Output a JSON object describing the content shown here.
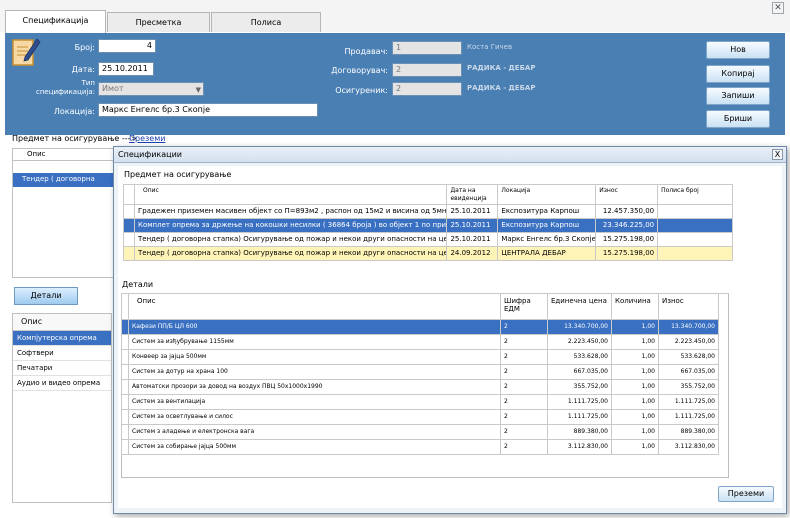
{
  "tabs": [
    {
      "label": "Спецификација",
      "active": true
    },
    {
      "label": "Пресметка",
      "active": false
    },
    {
      "label": "Полиса",
      "active": false
    }
  ],
  "header": {
    "broj_label": "Број:",
    "broj_value": "4",
    "datum_label": "Дата:",
    "datum_value": "25.10.2011",
    "tip_label": "Тип спецификација:",
    "tip_value": "Имот",
    "lokacija_label": "Локација:",
    "lokacija_value": "Маркс Енгелс бр.3 Скопје",
    "prodavac_label": "Продавач:",
    "prodavac_code": "1",
    "prodavac_name": "Коста Гичев",
    "dogovorvac_label": "Договорувач:",
    "dogovorvac_code": "2",
    "dogovorvac_name": "РАДИКА - ДЕБАР",
    "osiguren_label": "Осигуреник:",
    "osiguren_code": "2",
    "osiguren_name": "РАДИКА - ДЕБАР"
  },
  "actions": {
    "nov": "Нов",
    "kopiraj": "Копирај",
    "zapisi": "Запиши",
    "brisi": "Бриши"
  },
  "left": {
    "predmet_label": "Предмет на осигурување --->",
    "prezemi_link": "Преземи",
    "grid_header": "Опис",
    "grid_rows": [
      "Тендер ( договорна стапка)"
    ],
    "detali_button": "Детали",
    "cat_header": "Опис",
    "categories": [
      "Компјутерска опрема",
      "Софтвери",
      "Печатари",
      "Аудио и видео опрема"
    ]
  },
  "dialog": {
    "title": "Спецификации",
    "close": "X",
    "section1": "Предмет на осигурување",
    "grid1_headers": [
      "Опис",
      "Дата на евиденција",
      "Локација",
      "Износ",
      "Полиса број"
    ],
    "grid1_rows": [
      {
        "opis": "Градежен приземен масивен објект со П=893м2 , распон од 15м2 и висина од 5мна сума ...",
        "data": "25.10.2011",
        "lokacija": "Експозитура Карпош",
        "iznos": "12.457.350,00",
        "polisa": ""
      },
      {
        "opis": "Комплет опрема за држење на кокошки несилки ( 36864 броја ) во објект 1 по приложен...",
        "data": "25.10.2011",
        "lokacija": "Експозитура Карпош",
        "iznos": "23.346.225,00",
        "polisa": ""
      },
      {
        "opis": "Тендер ( договорна стапка) Осигурување од пожар и некои други опасности на целокуп...",
        "data": "25.10.2011",
        "lokacija": "Маркс Енгелс бр.3 Скопје",
        "iznos": "15.275.198,00",
        "polisa": ""
      },
      {
        "opis": "Тендер ( договорна стапка) Осигурување од пожар и некои други опасности на целокуп...",
        "data": "24.09.2012",
        "lokacija": "ЦЕНТРАЛА ДЕБАР",
        "iznos": "15.275.198,00",
        "polisa": ""
      }
    ],
    "section2": "Детали",
    "grid2_headers": [
      "Опис",
      "Шифра ЕДМ",
      "Единечна цена",
      "Количина",
      "Износ"
    ],
    "grid2_rows": [
      {
        "opis": "Кафези ПП/Б ЦЛ 600",
        "sifra": "2",
        "cena": "13.340.700,00",
        "kolicina": "1,00",
        "iznos": "13.340.700,00"
      },
      {
        "opis": "Систем за изђубрување 1155мм",
        "sifra": "2",
        "cena": "2.223.450,00",
        "kolicina": "1,00",
        "iznos": "2.223.450,00"
      },
      {
        "opis": "Конвеер за јајца 500мм",
        "sifra": "2",
        "cena": "533.628,00",
        "kolicina": "1,00",
        "iznos": "533.628,00"
      },
      {
        "opis": "Систем за дотур на храна 100",
        "sifra": "2",
        "cena": "667.035,00",
        "kolicina": "1,00",
        "iznos": "667.035,00"
      },
      {
        "opis": "Автоматски прозори за довод на воздух ПВЦ 50x1000x1990",
        "sifra": "2",
        "cena": "355.752,00",
        "kolicina": "1,00",
        "iznos": "355.752,00"
      },
      {
        "opis": "Систем за вентилација",
        "sifra": "2",
        "cena": "1.111.725,00",
        "kolicina": "1,00",
        "iznos": "1.111.725,00"
      },
      {
        "opis": "Систем за осветлување и силос",
        "sifra": "2",
        "cena": "1.111.725,00",
        "kolicina": "1,00",
        "iznos": "1.111.725,00"
      },
      {
        "opis": "Систем з аладење и електронска вага",
        "sifra": "2",
        "cena": "889.380,00",
        "kolicina": "1,00",
        "iznos": "889.380,00"
      },
      {
        "opis": "Систем за собирање јајца 500мм",
        "sifra": "2",
        "cena": "3.112.830,00",
        "kolicina": "1,00",
        "iznos": "3.112.830,00"
      }
    ],
    "prezemi_button": "Преземи"
  },
  "colors": {
    "header_bg": "#4a7fb4",
    "selection": "#3a70c2",
    "highlight_row": "#fff4b8"
  }
}
